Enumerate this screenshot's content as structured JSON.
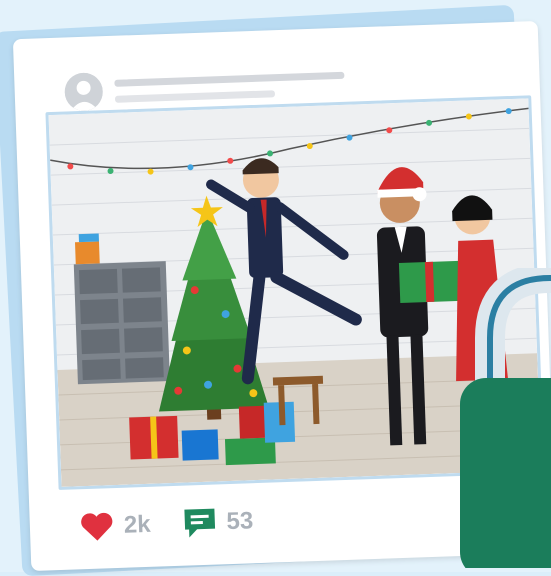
{
  "post": {
    "likes_count": "2k",
    "comments_count": "53"
  },
  "icons": {
    "avatar": "user-avatar-icon",
    "like": "heart-icon",
    "comment": "comment-bubble-icon",
    "lock": "padlock-icon"
  },
  "colors": {
    "like": "#e0313f",
    "comment": "#1f8a5f",
    "lock": "#1b7d5b",
    "card_border": "#bfdbef"
  }
}
